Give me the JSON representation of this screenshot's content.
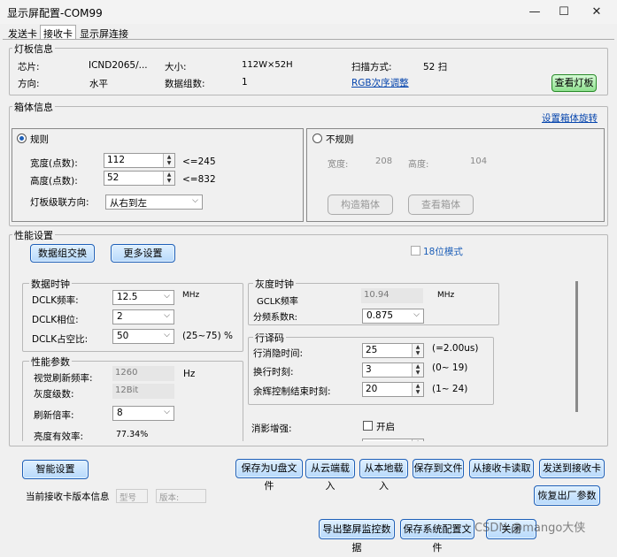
{
  "window": {
    "title": "显示屏配置-COM99",
    "minimize": "—",
    "maximize": "☐",
    "close": "✕"
  },
  "tabs": [
    "发送卡",
    "接收卡",
    "显示屏连接"
  ],
  "panel_info": {
    "title": "灯板信息",
    "chip_label": "芯片:",
    "chip_value": "ICND2065/...",
    "size_label": "大小:",
    "size_value": "112W×52H",
    "scan_label": "扫描方式:",
    "scan_value": "52 扫",
    "direction_label": "方向:",
    "direction_value": "水平",
    "groups_label": "数据组数:",
    "groups_value": "1",
    "rgb_link": "RGB次序调整",
    "view_panel_button": "查看灯板"
  },
  "cabinet": {
    "title": "箱体信息",
    "set_rotation_link": "设置箱体旋转",
    "regular_label": "规则",
    "width_label": "宽度(点数):",
    "width_value": "112",
    "width_limit": "<=245",
    "height_label": "高度(点数):",
    "height_value": "52",
    "height_limit": "<=832",
    "cascade_label": "灯板级联方向:",
    "cascade_value": "从右到左",
    "irregular_label": "不规则",
    "irr_width_label": "宽度:",
    "irr_width_value": "208",
    "irr_height_label": "高度:",
    "irr_height_value": "104",
    "construct_button": "构造箱体",
    "view_cabinet_button": "查看箱体"
  },
  "performance": {
    "title": "性能设置",
    "swap_button": "数据组交换",
    "more_button": "更多设置",
    "mode18_label": "18位模式",
    "data_clock": {
      "title": "数据时钟",
      "dclk_freq_label": "DCLK频率:",
      "dclk_freq_value": "12.5",
      "dclk_freq_unit": "MHz",
      "dclk_phase_label": "DCLK相位:",
      "dclk_phase_value": "2",
      "dclk_duty_label": "DCLK占空比:",
      "dclk_duty_value": "50",
      "dclk_duty_range": "(25~75) %"
    },
    "perf_params": {
      "title": "性能参数",
      "refresh_label": "视觉刷新频率:",
      "refresh_value": "1260",
      "refresh_unit": "Hz",
      "gray_label": "灰度级数:",
      "gray_value": "12Bit",
      "mult_label": "刷新倍率:",
      "mult_value": "8",
      "eff_label": "亮度有效率:",
      "eff_value": "77.34%"
    },
    "gray_clock": {
      "title": "灰度时钟",
      "gclk_label": "GCLK频率",
      "gclk_value": "10.94",
      "gclk_unit": "MHz",
      "div_label": "分频系数R:",
      "div_value": "0.875"
    },
    "line_decode": {
      "title": "行译码",
      "blank_label": "行消隐时间:",
      "blank_value": "25",
      "blank_note": "(=2.00us)",
      "switch_label": "换行时刻:",
      "switch_value": "3",
      "switch_range": "(0~ 19)",
      "after_label": "余辉控制结束时刻:",
      "after_value": "20",
      "after_range": "(1~ 24)"
    },
    "ghost_label": "消影增强:",
    "ghost_check_label": "开启"
  },
  "bottom": {
    "smart_button": "智能设置",
    "save_udisk": "保存为U盘文件",
    "cloud_load": "从云端载入",
    "local_load": "从本地载入",
    "save_file": "保存到文件",
    "read_card": "从接收卡读取",
    "send_card": "发送到接收卡",
    "version_label": "当前接收卡版本信息",
    "model_placeholder": "型号",
    "version_placeholder": "版本:",
    "restore_button": "恢复出厂参数",
    "export_monitor": "导出整屏监控数据",
    "save_sys": "保存系统配置文件",
    "close_button": "关闭",
    "watermark": "CSDN @mango大侠"
  }
}
